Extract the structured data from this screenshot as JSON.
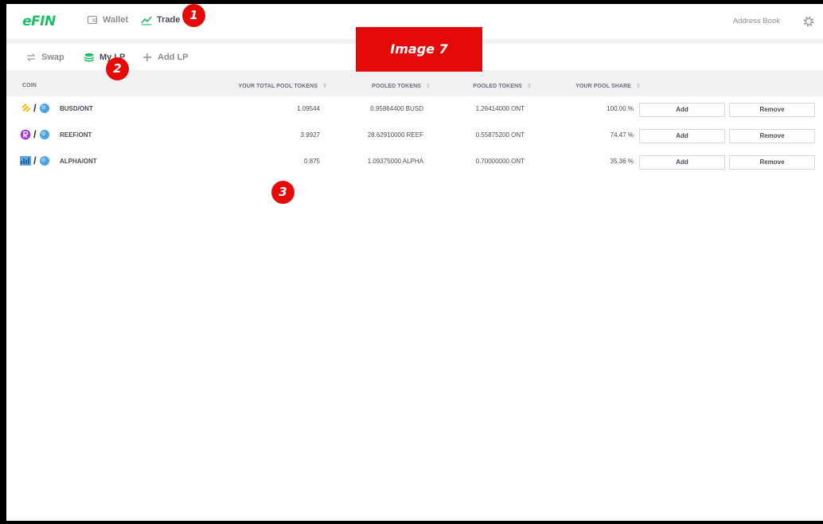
{
  "brand": {
    "logo_text": "eFIN",
    "accent": "#1fbf6a"
  },
  "topnav": {
    "items": [
      {
        "label": "Wallet",
        "icon": "wallet-icon"
      },
      {
        "label": "Trade",
        "icon": "trade-chart-icon"
      }
    ],
    "address_book": "Address Book",
    "settings_icon": "gear-icon"
  },
  "subnav": {
    "items": [
      {
        "label": "Swap",
        "icon": "swap-arrows-icon"
      },
      {
        "label": "My LP",
        "icon": "coin-stack-icon"
      },
      {
        "label": "Add LP",
        "icon": "plus-icon"
      }
    ]
  },
  "table": {
    "columns": [
      "COIN",
      "YOUR TOTAL POOL TOKENS",
      "POOLED TOKENS",
      "POOLED TOKENS",
      "YOUR POOL SHARE"
    ],
    "rows": [
      {
        "pair": "BUSD/ONT",
        "total": "1.09544",
        "pooled_a": "0.95864400 BUSD",
        "pooled_b": "1.26414000 ONT",
        "share": "100.00 %",
        "add": "Add",
        "remove": "Remove"
      },
      {
        "pair": "REEF/ONT",
        "total": "3.9927",
        "pooled_a": "28.62910000 REEF",
        "pooled_b": "0.55875200 ONT",
        "share": "74.47 %",
        "add": "Add",
        "remove": "Remove"
      },
      {
        "pair": "ALPHA/ONT",
        "total": "0.875",
        "pooled_a": "1.09375000 ALPHA",
        "pooled_b": "0.70000000 ONT",
        "share": "35.36 %",
        "add": "Add",
        "remove": "Remove"
      }
    ]
  },
  "overlay": {
    "image_label": "Image 7",
    "markers": [
      "1",
      "2",
      "3"
    ],
    "color": "#e40a0a"
  }
}
